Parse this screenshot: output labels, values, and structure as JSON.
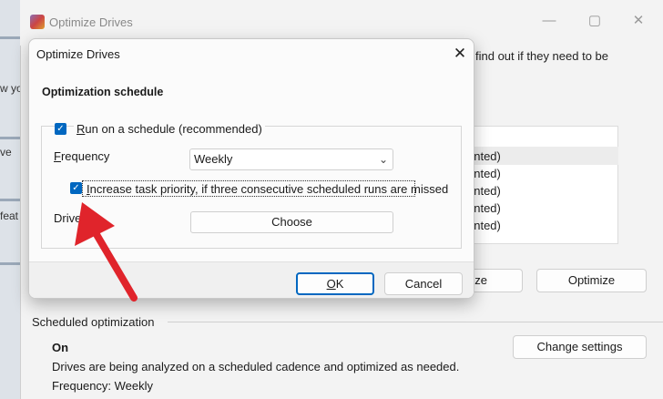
{
  "bg_window": {
    "title": "Optimize Drives",
    "description_fragment": "find out if they need to be",
    "list_rows": [
      "ented)",
      "ented)",
      "ented)",
      "ented)",
      "ented)"
    ],
    "analyze_button_fragment": "ze",
    "optimize_button": "Optimize",
    "scheduled_heading": "Scheduled optimization",
    "scheduled_status": "On",
    "scheduled_description": "Drives are being analyzed on a scheduled cadence and optimized as needed.",
    "scheduled_frequency": "Frequency: Weekly",
    "change_settings_button": "Change settings",
    "window_controls": [
      "minimize-icon",
      "maximize-icon",
      "close-icon"
    ]
  },
  "left_strip": {
    "text_1": "w yo",
    "text_2": "ve",
    "text_3": "feat"
  },
  "dialog": {
    "title": "Optimize Drives",
    "close_glyph": "✕",
    "heading": "Optimization schedule",
    "run_on_schedule": {
      "checked": true,
      "label_ul": "R",
      "label_rest": "un on a schedule (recommended)"
    },
    "frequency": {
      "label_ul": "F",
      "label_rest": "requency",
      "value": "Weekly"
    },
    "priority": {
      "checked": true,
      "label_ul": "I",
      "label_rest": "ncrease task priority, if three consecutive scheduled runs are missed"
    },
    "drives": {
      "label": "Drives",
      "choose_button": "Choose"
    },
    "ok_button_ul": "O",
    "ok_button_rest": "K",
    "cancel_button": "Cancel"
  },
  "colors": {
    "accent": "#0067c0",
    "annotation_arrow": "#e0242b"
  }
}
